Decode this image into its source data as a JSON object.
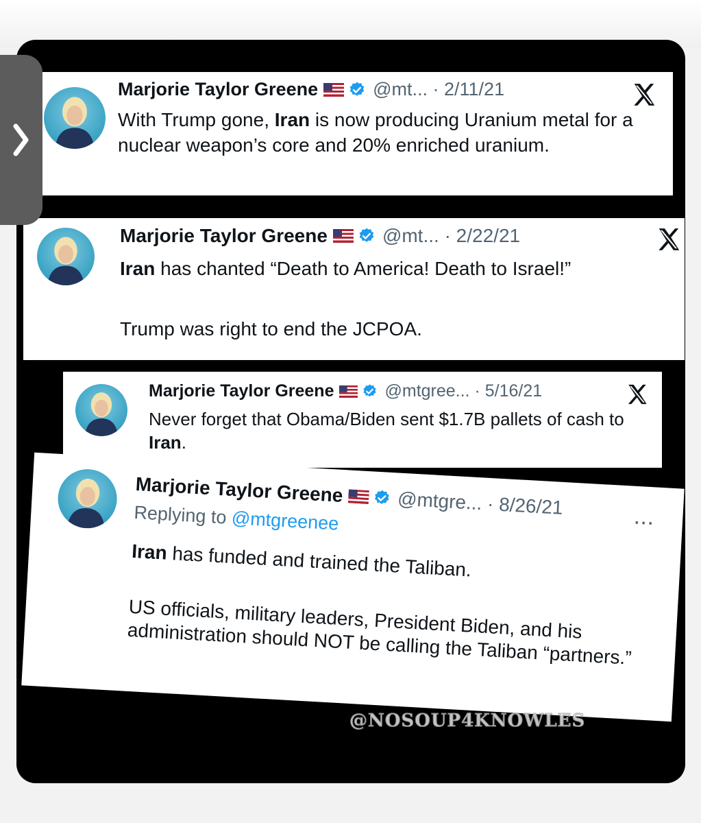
{
  "author": {
    "name": "Marjorie Taylor Greene"
  },
  "icons": {
    "flag": "us-flag-icon",
    "verified": "verified-badge-icon",
    "platform": "x-logo-icon",
    "nav": "chevron-right-icon",
    "more": "more-options-icon"
  },
  "colors": {
    "background": "#000000",
    "card": "#ffffff",
    "text": "#0f1419",
    "muted": "#536471",
    "verified": "#1d9bf0",
    "tab": "#5c5c5c"
  },
  "tweets": [
    {
      "handle_date": "@mt... · 2/11/21",
      "parts": [
        "With Trump gone, ",
        "Iran",
        " is now producing Uranium metal for a nuclear weapon’s core and 20% enriched uranium."
      ]
    },
    {
      "handle_date": "@mt... · 2/22/21",
      "parts": [
        "Iran",
        " has chanted “Death to America! Death to Israel!”"
      ],
      "line2": "Trump was right to end the JCPOA."
    },
    {
      "handle_date": "@mtgree... · 5/16/21",
      "parts": [
        "Never forget that Obama/Biden sent $1.7B pallets of cash to ",
        "Iran",
        "."
      ]
    },
    {
      "handle_date": "@mtgre... · 8/26/21",
      "reply_prefix": "Replying to ",
      "reply_to": "@mtgreenee",
      "more": "···",
      "parts": [
        "Iran",
        " has funded and trained the Taliban."
      ],
      "line2": "US officials, military leaders, President Biden, and his administration should NOT be calling the Taliban “partners.”"
    }
  ],
  "watermark": "@NOSOUP4KNOWLES"
}
